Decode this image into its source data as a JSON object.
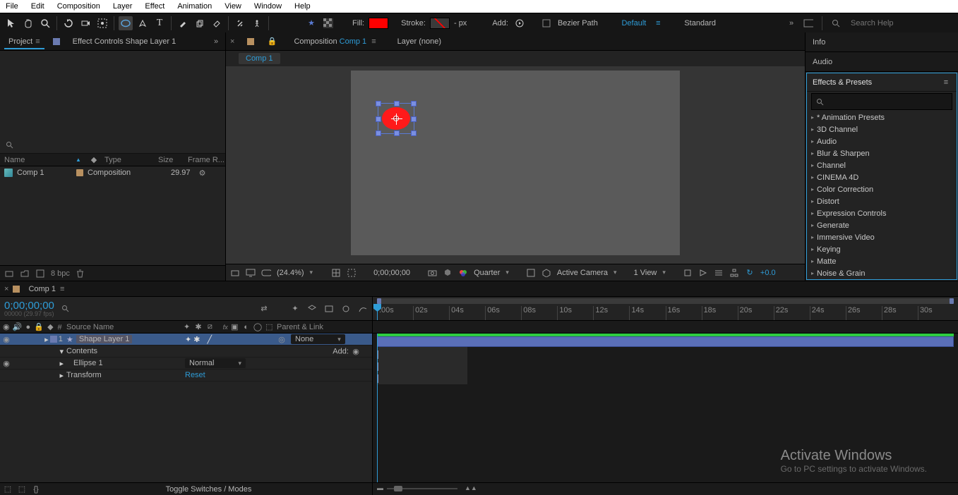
{
  "menu": [
    "File",
    "Edit",
    "Composition",
    "Layer",
    "Effect",
    "Animation",
    "View",
    "Window",
    "Help"
  ],
  "toolbar": {
    "fill_label": "Fill:",
    "stroke_label": "Stroke:",
    "stroke_px": "- px",
    "add_label": "Add:",
    "bezier_label": "Bezier Path",
    "workspace_default": "Default",
    "workspace_standard": "Standard",
    "search_placeholder": "Search Help"
  },
  "project": {
    "tab_project": "Project",
    "tab_effect_controls": "Effect Controls Shape Layer 1",
    "cols": {
      "name": "Name",
      "type": "Type",
      "size": "Size",
      "frame": "Frame R..."
    },
    "item": {
      "name": "Comp 1",
      "type": "Composition",
      "fps": "29.97"
    },
    "footer_bpc": "8 bpc"
  },
  "composition": {
    "tab_label": "Composition",
    "tab_comp_name": "Comp 1",
    "layer_tab": "Layer (none)",
    "sub_tab": "Comp 1",
    "footer": {
      "zoom": "(24.4%)",
      "time": "0;00;00;00",
      "res": "Quarter",
      "camera": "Active Camera",
      "view": "1 View",
      "exposure": "+0.0"
    }
  },
  "right": {
    "info": "Info",
    "audio": "Audio",
    "ep_title": "Effects & Presets",
    "ep_items": [
      "* Animation Presets",
      "3D Channel",
      "Audio",
      "Blur & Sharpen",
      "Channel",
      "CINEMA 4D",
      "Color Correction",
      "Distort",
      "Expression Controls",
      "Generate",
      "Immersive Video",
      "Keying",
      "Matte",
      "Noise & Grain"
    ]
  },
  "timeline": {
    "tab": "Comp 1",
    "timecode": "0;00;00;00",
    "timecode_sub": "00000 (29.97 fps)",
    "cols": {
      "num": "#",
      "source": "Source Name",
      "parent": "Parent & Link"
    },
    "layer": {
      "num": "1",
      "name": "Shape Layer 1",
      "parent_none": "None"
    },
    "contents": "Contents",
    "add": "Add:",
    "ellipse": "Ellipse 1",
    "ellipse_mode": "Normal",
    "transform": "Transform",
    "reset": "Reset",
    "footer": "Toggle Switches / Modes",
    "ticks": [
      ":00s",
      "02s",
      "04s",
      "06s",
      "08s",
      "10s",
      "12s",
      "14s",
      "16s",
      "18s",
      "20s",
      "22s",
      "24s",
      "26s",
      "28s",
      "30s"
    ]
  },
  "watermark": {
    "line1": "Activate Windows",
    "line2": "Go to PC settings to activate Windows."
  }
}
